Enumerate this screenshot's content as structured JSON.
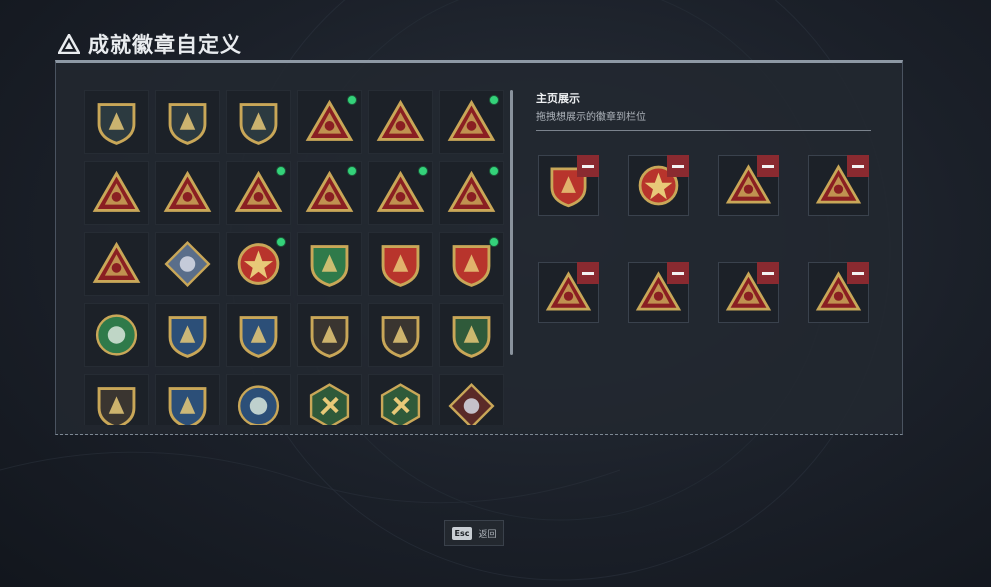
{
  "header": {
    "title": "成就徽章自定义",
    "icon": "triangle-logo-icon"
  },
  "display": {
    "title": "主页展示",
    "subtitle": "拖拽想展示的徽章到栏位",
    "slots": [
      {
        "icon": "shield-star-badge-icon",
        "color": "#b8342c"
      },
      {
        "icon": "star-medallion-badge-icon",
        "color": "#b8342c"
      },
      {
        "icon": "eye-triangle-badge-icon",
        "color": "#8a1f22"
      },
      {
        "icon": "jar-triangle-badge-icon",
        "color": "#8a1f22"
      },
      {
        "icon": "robot-triangle-badge-icon",
        "color": "#8a1f22"
      },
      {
        "icon": "box-triangle-badge-icon",
        "color": "#8a1f22"
      },
      {
        "icon": "soldier-triangle-badge-icon",
        "color": "#8a1f22"
      },
      {
        "icon": "winged-triangle-badge-icon",
        "color": "#8a1f22"
      }
    ]
  },
  "collection": {
    "badges": [
      {
        "icon": "mountain-shield-badge-icon",
        "shape": "shield",
        "color": "#2c3a40",
        "new": false
      },
      {
        "icon": "helicopter-badge-icon",
        "shape": "shield",
        "color": "#2c3a40",
        "new": false
      },
      {
        "icon": "arrow-shield-badge-icon",
        "shape": "shield",
        "color": "#2c3a40",
        "new": false
      },
      {
        "icon": "eye-triangle-badge-icon",
        "shape": "triangle",
        "color": "#8a1f22",
        "new": true
      },
      {
        "icon": "vest-triangle-badge-icon",
        "shape": "triangle",
        "color": "#8a1f22",
        "new": false
      },
      {
        "icon": "robot-triangle-badge-icon",
        "shape": "triangle",
        "color": "#8a1f22",
        "new": true
      },
      {
        "icon": "helmet-triangle-badge-icon",
        "shape": "triangle",
        "color": "#8a1f22",
        "new": false
      },
      {
        "icon": "number-one-triangle-badge-icon",
        "shape": "triangle",
        "color": "#8a1f22",
        "new": false
      },
      {
        "icon": "box-triangle-badge-icon",
        "shape": "triangle",
        "color": "#8a1f22",
        "new": true
      },
      {
        "icon": "jar-triangle-badge-icon",
        "shape": "triangle",
        "color": "#8a1f22",
        "new": true
      },
      {
        "icon": "winged-triangle-badge-icon",
        "shape": "triangle",
        "color": "#8a1f22",
        "new": true
      },
      {
        "icon": "soldier-triangle-badge-icon",
        "shape": "triangle",
        "color": "#8a1f22",
        "new": true
      },
      {
        "icon": "tower-triangle-badge-icon",
        "shape": "triangle",
        "color": "#8a1f22",
        "new": false
      },
      {
        "icon": "blue-diamond-badge-icon",
        "shape": "diamond",
        "color": "#5a6e8a",
        "new": false
      },
      {
        "icon": "star-medallion-badge-icon",
        "shape": "medallion",
        "color": "#b8342c",
        "new": true
      },
      {
        "icon": "green-shield-badge-icon",
        "shape": "shield",
        "color": "#2f7a4a",
        "new": false
      },
      {
        "icon": "winged-shield-badge-icon",
        "shape": "shield",
        "color": "#b8342c",
        "new": false
      },
      {
        "icon": "shield-star-badge-icon",
        "shape": "shield",
        "color": "#b8342c",
        "new": true
      },
      {
        "icon": "laurel-round-badge-icon",
        "shape": "round",
        "color": "#2f7a4a",
        "new": false
      },
      {
        "icon": "blue-crosshair-shield-badge-icon",
        "shape": "shield",
        "color": "#2c4f78",
        "new": false
      },
      {
        "icon": "blue-crosshair-shield-2-badge-icon",
        "shape": "shield",
        "color": "#2c4f78",
        "new": false
      },
      {
        "icon": "no-gun-shield-badge-icon",
        "shape": "shield",
        "color": "#3a3530",
        "new": false
      },
      {
        "icon": "no-gun-shield-2-badge-icon",
        "shape": "shield",
        "color": "#3a3530",
        "new": false
      },
      {
        "icon": "green-crosshair-shield-badge-icon",
        "shape": "shield",
        "color": "#2f5a3a",
        "new": false
      },
      {
        "icon": "gold-shield-badge-icon",
        "shape": "shield",
        "color": "#3a3530",
        "new": false
      },
      {
        "icon": "gold-cross-badge-icon",
        "shape": "shield",
        "color": "#2c4f78",
        "new": false
      },
      {
        "icon": "eagle-badge-icon",
        "shape": "round",
        "color": "#2c4f78",
        "new": false
      },
      {
        "icon": "wasp-hexagon-badge-icon",
        "shape": "hexagon",
        "color": "#2f5a3a",
        "new": false
      },
      {
        "icon": "rocket-hexagon-badge-icon",
        "shape": "hexagon",
        "color": "#2f5a3a",
        "new": false
      },
      {
        "icon": "dragon-diamond-badge-icon",
        "shape": "diamond",
        "color": "#5a2a28",
        "new": false
      }
    ]
  },
  "footer": {
    "key": "Esc",
    "label": "返回"
  }
}
